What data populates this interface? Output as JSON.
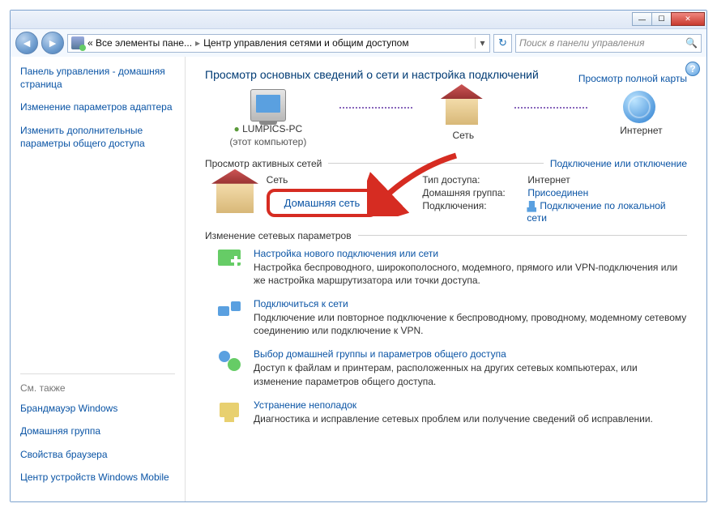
{
  "breadcrumb": {
    "part1": "« Все элементы пане...",
    "part2": "Центр управления сетями и общим доступом"
  },
  "search": {
    "placeholder": "Поиск в панели управления"
  },
  "sidebar": {
    "links": [
      "Панель управления - домашняя страница",
      "Изменение параметров адаптера",
      "Изменить дополнительные параметры общего доступа"
    ],
    "seealso_title": "См. также",
    "seealso": [
      "Брандмауэр Windows",
      "Домашняя группа",
      "Свойства браузера",
      "Центр устройств Windows Mobile"
    ]
  },
  "main": {
    "heading": "Просмотр основных сведений о сети и настройка подключений",
    "fullmap": "Просмотр полной карты",
    "map": {
      "pc": "LUMPICS-PC",
      "pc_sub": "(этот компьютер)",
      "net": "Сеть",
      "internet": "Интернет"
    },
    "active_section": "Просмотр активных сетей",
    "connect_link": "Подключение или отключение",
    "network": {
      "name": "Сеть",
      "type": "Домашняя сеть",
      "access_lbl": "Тип доступа:",
      "access_val": "Интернет",
      "group_lbl": "Домашняя группа:",
      "group_val": "Присоединен",
      "conn_lbl": "Подключения:",
      "conn_val": "Подключение по локальной сети"
    },
    "params_section": "Изменение сетевых параметров",
    "tasks": [
      {
        "title": "Настройка нового подключения или сети",
        "desc": "Настройка беспроводного, широкополосного, модемного, прямого или VPN-подключения или же настройка маршрутизатора или точки доступа."
      },
      {
        "title": "Подключиться к сети",
        "desc": "Подключение или повторное подключение к беспроводному, проводному, модемному сетевому соединению или подключение к VPN."
      },
      {
        "title": "Выбор домашней группы и параметров общего доступа",
        "desc": "Доступ к файлам и принтерам, расположенных на других сетевых компьютерах, или изменение параметров общего доступа."
      },
      {
        "title": "Устранение неполадок",
        "desc": "Диагностика и исправление сетевых проблем или получение сведений об исправлении."
      }
    ]
  }
}
